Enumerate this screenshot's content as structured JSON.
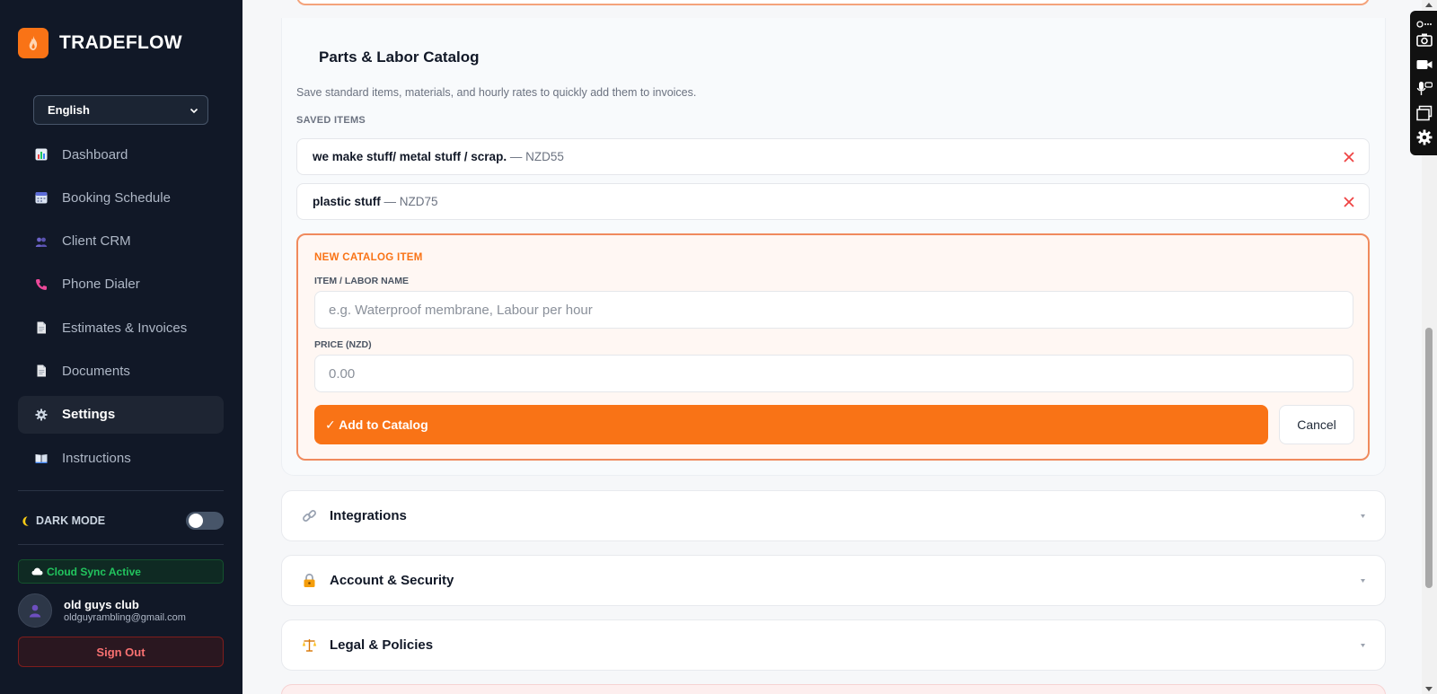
{
  "brand": {
    "name": "TRADEFLOW",
    "accent": "#f97316"
  },
  "sidebar": {
    "language": "English",
    "items": [
      {
        "label": "Dashboard",
        "icon": "bar-chart-icon"
      },
      {
        "label": "Booking Schedule",
        "icon": "calendar-icon"
      },
      {
        "label": "Client CRM",
        "icon": "people-icon"
      },
      {
        "label": "Phone Dialer",
        "icon": "phone-icon"
      },
      {
        "label": "Estimates & Invoices",
        "icon": "document-icon"
      },
      {
        "label": "Documents",
        "icon": "document-icon"
      },
      {
        "label": "Settings",
        "icon": "gear-icon",
        "active": true
      },
      {
        "label": "Instructions",
        "icon": "book-icon"
      }
    ],
    "dark_mode_label": "DARK MODE",
    "dark_mode_on": false,
    "sync_status": "Cloud Sync Active",
    "user": {
      "name": "old guys club",
      "email": "oldguyrambling@gmail.com"
    },
    "sign_out": "Sign Out"
  },
  "catalog": {
    "title": "Parts & Labor Catalog",
    "description": "Save standard items, materials, and hourly rates to quickly add them to invoices.",
    "saved_label": "SAVED ITEMS",
    "items": [
      {
        "name": "we make stuff/ metal stuff / scrap.",
        "price": " — NZD55"
      },
      {
        "name": "plastic stuff",
        "price": " — NZD75"
      }
    ],
    "new_item": {
      "title": "NEW CATALOG ITEM",
      "name_label": "ITEM / LABOR NAME",
      "name_placeholder": "e.g. Waterproof membrane, Labour per hour",
      "price_label": "PRICE (NZD)",
      "price_placeholder": "0.00",
      "add_button": "✓ Add to Catalog",
      "cancel_button": "Cancel"
    }
  },
  "sections": [
    {
      "title": "Integrations",
      "icon": "link-icon"
    },
    {
      "title": "Account & Security",
      "icon": "lock-icon"
    },
    {
      "title": "Legal & Policies",
      "icon": "scales-icon"
    }
  ],
  "extension_toolbar": [
    "screenshot-icon",
    "video-icon",
    "microphone-icon",
    "window-icon",
    "gear-icon"
  ]
}
